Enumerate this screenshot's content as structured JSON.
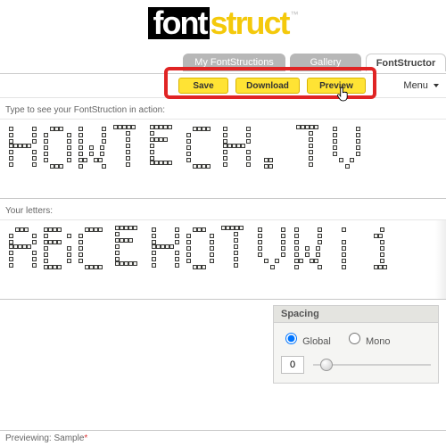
{
  "logo": {
    "first": "font",
    "second": "struct",
    "tm": "™"
  },
  "tabs": {
    "my": "My FontStructions",
    "gallery": "Gallery",
    "active": "FontStructor"
  },
  "toolbar": {
    "save": "Save",
    "download": "Download",
    "preview": "Preview",
    "menu": "Menu"
  },
  "preview": {
    "label": "Type to see your FontStruction in action:",
    "text": "HOWTECH.TV"
  },
  "letters": {
    "label": "Your letters:",
    "set": "ABCEHOTVWi1"
  },
  "spacing": {
    "title": "Spacing",
    "global": "Global",
    "mono": "Mono",
    "mode": "global",
    "value": "0"
  },
  "footer": {
    "label": "Previewing:",
    "sample": "Sample",
    "ast": "*"
  },
  "glyphs5x7": {
    "A": [
      "01110",
      "10001",
      "10001",
      "11111",
      "10001",
      "10001",
      "10001"
    ],
    "B": [
      "11110",
      "10001",
      "11110",
      "10001",
      "10001",
      "10001",
      "11110"
    ],
    "C": [
      "01111",
      "10000",
      "10000",
      "10000",
      "10000",
      "10000",
      "01111"
    ],
    "E": [
      "11111",
      "10000",
      "11110",
      "10000",
      "10000",
      "10000",
      "11111"
    ],
    "H": [
      "10001",
      "10001",
      "10001",
      "11111",
      "10001",
      "10001",
      "10001"
    ],
    "O": [
      "01110",
      "10001",
      "10001",
      "10001",
      "10001",
      "10001",
      "01110"
    ],
    "T": [
      "11111",
      "00100",
      "00100",
      "00100",
      "00100",
      "00100",
      "00100"
    ],
    "V": [
      "10001",
      "10001",
      "10001",
      "10001",
      "10001",
      "01010",
      "00100"
    ],
    "W": [
      "10001",
      "10001",
      "10001",
      "10101",
      "10101",
      "11011",
      "10001"
    ],
    "i": [
      "00100",
      "00000",
      "00100",
      "00100",
      "00100",
      "00100",
      "00100"
    ],
    "1": [
      "00100",
      "01100",
      "00100",
      "00100",
      "00100",
      "00100",
      "01110"
    ],
    ".": [
      "00000",
      "00000",
      "00000",
      "00000",
      "00000",
      "01100",
      "01100"
    ]
  }
}
